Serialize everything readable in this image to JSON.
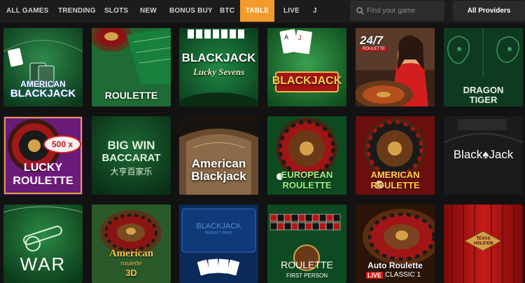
{
  "nav": {
    "tabs": [
      {
        "label": "ALL GAMES"
      },
      {
        "label": "TRENDING"
      },
      {
        "label": "SLOTS"
      },
      {
        "label": "NEW"
      },
      {
        "label": "BONUS BUY"
      },
      {
        "label": "BTC"
      },
      {
        "label": "TABLE"
      },
      {
        "label": "LIVE"
      },
      {
        "label": "J"
      }
    ],
    "active_tab": "TABLE",
    "accent_color": "#f29b2c"
  },
  "search": {
    "placeholder": "Find your game",
    "icon": "search-icon"
  },
  "providers": {
    "selected": "All Providers"
  },
  "games": [
    {
      "line1": "AMERICAN",
      "line2": "BLACKJACK"
    },
    {
      "line1": "ROULETTE"
    },
    {
      "line1": "BLACKJACK",
      "line2": "Lucky Sevens"
    },
    {
      "line1": "BLACKJACK"
    },
    {
      "line1": "24/7",
      "line2": "ROULETTE"
    },
    {
      "line1": "DRAGON",
      "line2": "TIGER"
    },
    {
      "line1": "500 x",
      "line2": "LUCKY",
      "line3": "ROULETTE"
    },
    {
      "line1": "BIG WIN",
      "line2": "BACCARAT",
      "line3": "大亨百家乐"
    },
    {
      "line1": "American",
      "line2": "Blackjack"
    },
    {
      "line1": "EUROPEAN",
      "line2": "ROULETTE"
    },
    {
      "line1": "AMERICAN",
      "line2": "ROULETTE"
    },
    {
      "line1": "Black",
      "line2": "Jack"
    },
    {
      "line1": "WAR"
    },
    {
      "line1": "American",
      "line2": "roulette",
      "line3": "3D"
    },
    {
      "line1": "BLACKJACK",
      "line2": "PERFECT PAIRS"
    },
    {
      "line1": "ROULETTE",
      "line2": "FIRST PERSON"
    },
    {
      "line1": "Auto Roulette",
      "line2": "LIVE",
      "line3": "CLASSIC 1"
    },
    {
      "line1": "TEXAS",
      "line2": "HOLD'EM"
    }
  ]
}
